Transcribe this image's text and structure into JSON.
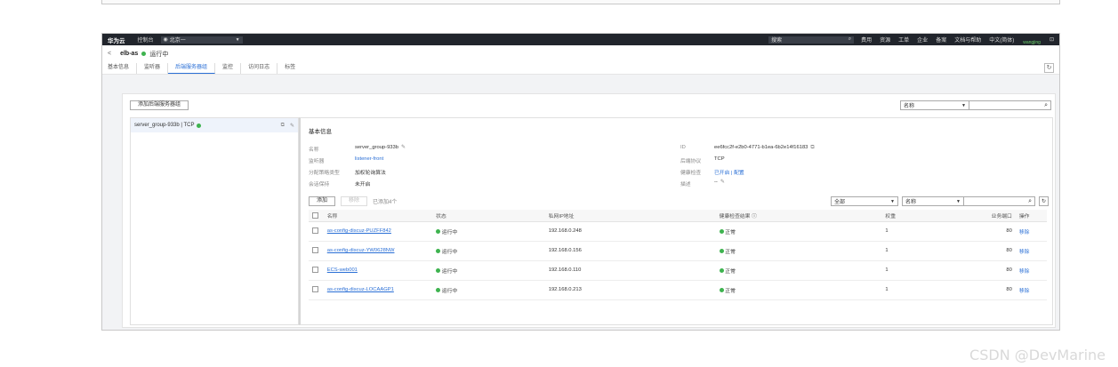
{
  "topbar": {
    "brand": "华为云",
    "console": "控制台",
    "region": "北京一",
    "search_placeholder": "搜索",
    "nav": [
      "费用",
      "资源",
      "工单",
      "企业",
      "备案",
      "文档与帮助",
      "中文(简体)"
    ],
    "username": "wangjing"
  },
  "header": {
    "back": "<",
    "title": "elb-as",
    "status": "运行中",
    "tabs": [
      "基本信息",
      "监听器",
      "后端服务器组",
      "监控",
      "访问日志",
      "标签"
    ],
    "active_tab": 2,
    "refresh_icon": "refresh-icon"
  },
  "main": {
    "add_group_label": "添加后端服务器组",
    "filter_select": "名称",
    "group_item": "server_group-933b | TCP",
    "basic_info_title": "基本信息",
    "left_fields": [
      {
        "k": "名称",
        "v": "server_group-933b"
      },
      {
        "k": "监听器",
        "v": "listener-front"
      },
      {
        "k": "分配策略类型",
        "v": "加权轮询算法"
      },
      {
        "k": "会话保持",
        "v": "未开启"
      }
    ],
    "right_fields": [
      {
        "k": "ID",
        "v": "ee6fcc2f-e2b0-4771-b1ea-6b2e14f16183"
      },
      {
        "k": "后端协议",
        "v": "TCP"
      },
      {
        "k": "健康检查",
        "v": "已开启 | 配置"
      },
      {
        "k": "描述",
        "v": "--"
      }
    ],
    "add_button": "添加",
    "remove_button": "移除",
    "selected_text": "已添加4个",
    "all_select": "全部",
    "name_select": "名称",
    "table": {
      "headers": [
        "名称",
        "状态",
        "私网IP地址",
        "健康检查结果",
        "权重",
        "业务端口",
        "操作"
      ],
      "rows": [
        {
          "name": "as-config-discuz-PUZFF842",
          "status": "运行中",
          "ip": "192.168.0.248",
          "health": "正常",
          "weight": "1",
          "port": "80",
          "op": "移除"
        },
        {
          "name": "as-config-discuz-YW0628NW",
          "status": "运行中",
          "ip": "192.168.0.156",
          "health": "正常",
          "weight": "1",
          "port": "80",
          "op": "移除"
        },
        {
          "name": "ECS-web001",
          "status": "运行中",
          "ip": "192.168.0.110",
          "health": "正常",
          "weight": "1",
          "port": "80",
          "op": "移除"
        },
        {
          "name": "as-config-discuz-LOCAAGP1",
          "status": "运行中",
          "ip": "192.168.0.213",
          "health": "正常",
          "weight": "1",
          "port": "80",
          "op": "移除"
        }
      ]
    }
  },
  "watermark": "CSDN @DevMarine",
  "colors": {
    "accent": "#2a6fd6",
    "ok": "#3eb34f",
    "topbar": "#21252c"
  }
}
